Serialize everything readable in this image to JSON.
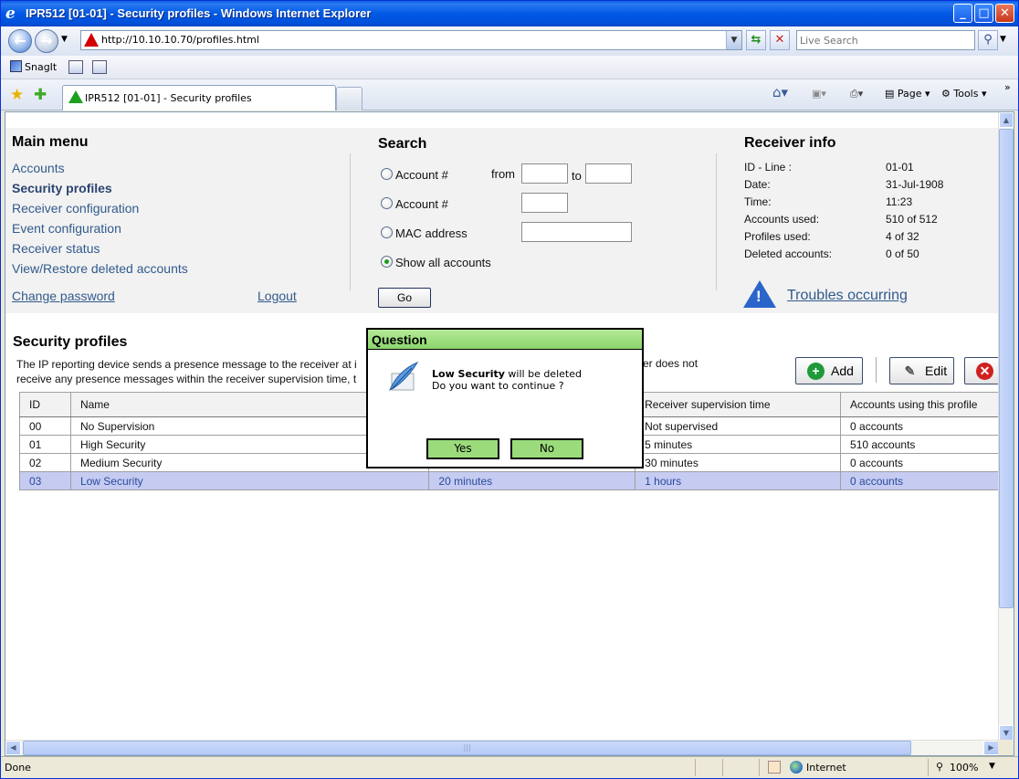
{
  "window": {
    "title": "IPR512 [01-01] - Security profiles - Windows Internet Explorer"
  },
  "address": {
    "url": "http://10.10.10.70/profiles.html",
    "search_placeholder": "Live Search"
  },
  "links_bar": {
    "snagit": "SnagIt"
  },
  "tabs": {
    "active_label": "IPR512 [01-01] - Security profiles"
  },
  "commands": {
    "page": "Page",
    "tools": "Tools"
  },
  "main_menu": {
    "title": "Main menu",
    "items": [
      "Accounts",
      "Security profiles",
      "Receiver configuration",
      "Event configuration",
      "Receiver status",
      "View/Restore deleted accounts"
    ],
    "change_password": "Change password",
    "logout": "Logout"
  },
  "search": {
    "title": "Search",
    "opt1": "Account #",
    "from": "from",
    "to": "to",
    "opt2": "Account #",
    "opt3": "MAC address",
    "opt4": "Show all accounts",
    "go": "Go"
  },
  "receiver_info": {
    "title": "Receiver info",
    "rows": [
      {
        "k": "ID - Line :",
        "v": "01-01"
      },
      {
        "k": "Date:",
        "v": "31-Jul-1908"
      },
      {
        "k": "Time:",
        "v": "11:23"
      },
      {
        "k": "Accounts used:",
        "v": "510 of 512"
      },
      {
        "k": "Profiles used:",
        "v": "4 of 32"
      },
      {
        "k": "Deleted accounts:",
        "v": "0 of 50"
      }
    ],
    "troubles": "Troubles occurring"
  },
  "profiles": {
    "title": "Security profiles",
    "desc_line1": "The IP reporting device sends a presence message to the receiver at i",
    "desc_line2": "receive any presence messages within the receiver supervision time, t",
    "desc_right": "er does not",
    "add": "Add",
    "edit": "Edit",
    "columns": [
      "ID",
      "Name",
      "",
      "Receiver supervision time",
      "Accounts using this profile"
    ],
    "rows": [
      {
        "id": "00",
        "name": "No Supervision",
        "c3": "",
        "sup": "Not supervised",
        "acc": "0 accounts"
      },
      {
        "id": "01",
        "name": "High Security",
        "c3": "",
        "sup": "5 minutes",
        "acc": "510 accounts"
      },
      {
        "id": "02",
        "name": "Medium Security",
        "c3": "",
        "sup": "30 minutes",
        "acc": "0 accounts"
      },
      {
        "id": "03",
        "name": "Low Security",
        "c3": "20 minutes",
        "sup": "1 hours",
        "acc": "0 accounts"
      }
    ]
  },
  "dialog": {
    "title": "Question",
    "profile_name": "Low Security",
    "msg_suffix": " will be deleted",
    "msg2": "Do you want to continue ?",
    "yes": "Yes",
    "no": "No"
  },
  "status": {
    "text": "Done",
    "zone": "Internet",
    "zoom": "100%"
  },
  "colors": {
    "accent": "#0058E6",
    "link": "#315A8C",
    "dialog_header": "#8BD56D",
    "selected_row": "#C5CBF1"
  }
}
